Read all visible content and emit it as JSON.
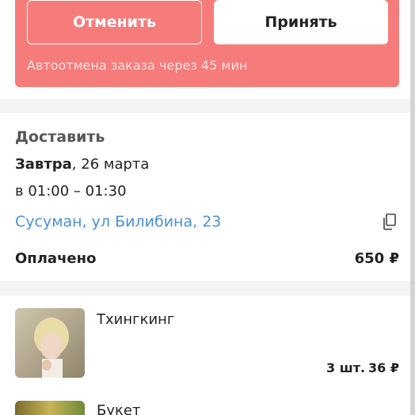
{
  "actions": {
    "cancel_label": "Отменить",
    "accept_label": "Принять",
    "autocancel_text": "Автоотмена заказа через 45 мин"
  },
  "delivery": {
    "heading": "Доставить",
    "date_bold": "Завтра",
    "date_rest": ", 26 марта",
    "time": "в 01:00 – 01:30",
    "address": "Сусуман, ул Билибина, 23"
  },
  "payment": {
    "label": "Оплачено",
    "amount": "650 ₽"
  },
  "items": [
    {
      "name": "Тхингкинг",
      "quantity": "3 шт.",
      "price": "36 ₽",
      "thumbnail": "photo-of-person"
    },
    {
      "name": "Букет",
      "thumbnail": "bouquet-photo"
    }
  ],
  "colors": {
    "banner": "#f67c7b",
    "link": "#4a90d9",
    "separator": "#f4f4f4"
  },
  "icons": {
    "copy": "copy-icon"
  }
}
